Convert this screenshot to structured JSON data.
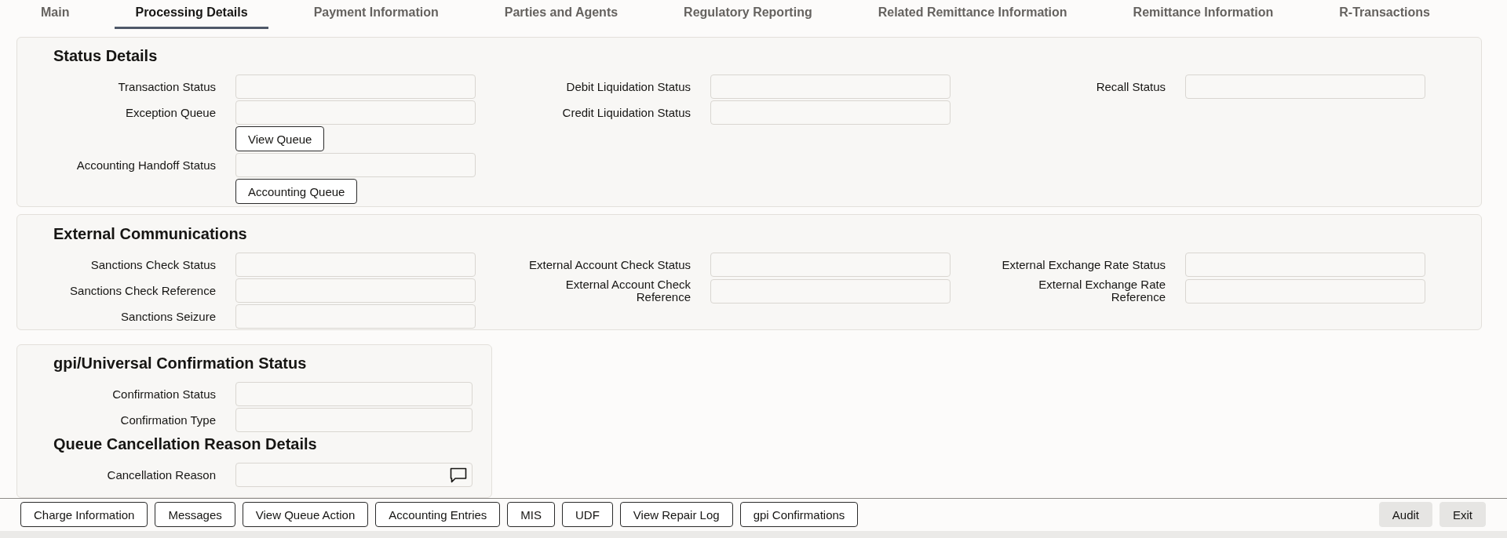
{
  "tabs": [
    {
      "label": "Main",
      "selected": false
    },
    {
      "label": "Processing Details",
      "selected": true
    },
    {
      "label": "Payment Information",
      "selected": false
    },
    {
      "label": "Parties and Agents",
      "selected": false
    },
    {
      "label": "Regulatory Reporting",
      "selected": false
    },
    {
      "label": "Related Remittance Information",
      "selected": false
    },
    {
      "label": "Remittance Information",
      "selected": false
    },
    {
      "label": "R-Transactions",
      "selected": false
    }
  ],
  "sections": [
    {
      "title": "Status Details",
      "columns": [
        [
          {
            "kind": "field",
            "label": "Transaction Status"
          },
          {
            "kind": "field",
            "label": "Exception Queue"
          },
          {
            "kind": "button",
            "label": "View Queue"
          },
          {
            "kind": "field",
            "label": "Accounting Handoff Status"
          },
          {
            "kind": "button",
            "label": "Accounting Queue"
          }
        ],
        [
          {
            "kind": "field",
            "label": "Debit Liquidation Status"
          },
          {
            "kind": "field",
            "label": "Credit Liquidation Status"
          }
        ],
        [
          {
            "kind": "field",
            "label": "Recall Status"
          }
        ]
      ]
    },
    {
      "title": "External Communications",
      "columns": [
        [
          {
            "kind": "field",
            "label": "Sanctions Check Status"
          },
          {
            "kind": "field",
            "label": "Sanctions Check Reference"
          },
          {
            "kind": "field",
            "label": "Sanctions Seizure"
          }
        ],
        [
          {
            "kind": "field",
            "label": "External Account Check Status"
          },
          {
            "kind": "field",
            "label": "External Account Check Reference"
          }
        ],
        [
          {
            "kind": "field",
            "label": "External Exchange Rate Status"
          },
          {
            "kind": "field",
            "label": "External Exchange Rate Reference"
          }
        ]
      ]
    }
  ],
  "confirmation_panel": {
    "groups": [
      {
        "title": "gpi/Universal Confirmation Status",
        "items": [
          {
            "kind": "field",
            "label": "Confirmation Status"
          },
          {
            "kind": "field",
            "label": "Confirmation Type"
          }
        ]
      },
      {
        "title": "Queue Cancellation Reason Details",
        "items": [
          {
            "kind": "comment_field",
            "label": "Cancellation Reason"
          }
        ]
      }
    ]
  },
  "footer": {
    "buttons": [
      "Charge Information",
      "Messages",
      "View Queue Action",
      "Accounting Entries",
      "MIS",
      "UDF",
      "View Repair Log",
      "gpi Confirmations"
    ],
    "right_buttons": [
      "Audit",
      "Exit"
    ]
  }
}
